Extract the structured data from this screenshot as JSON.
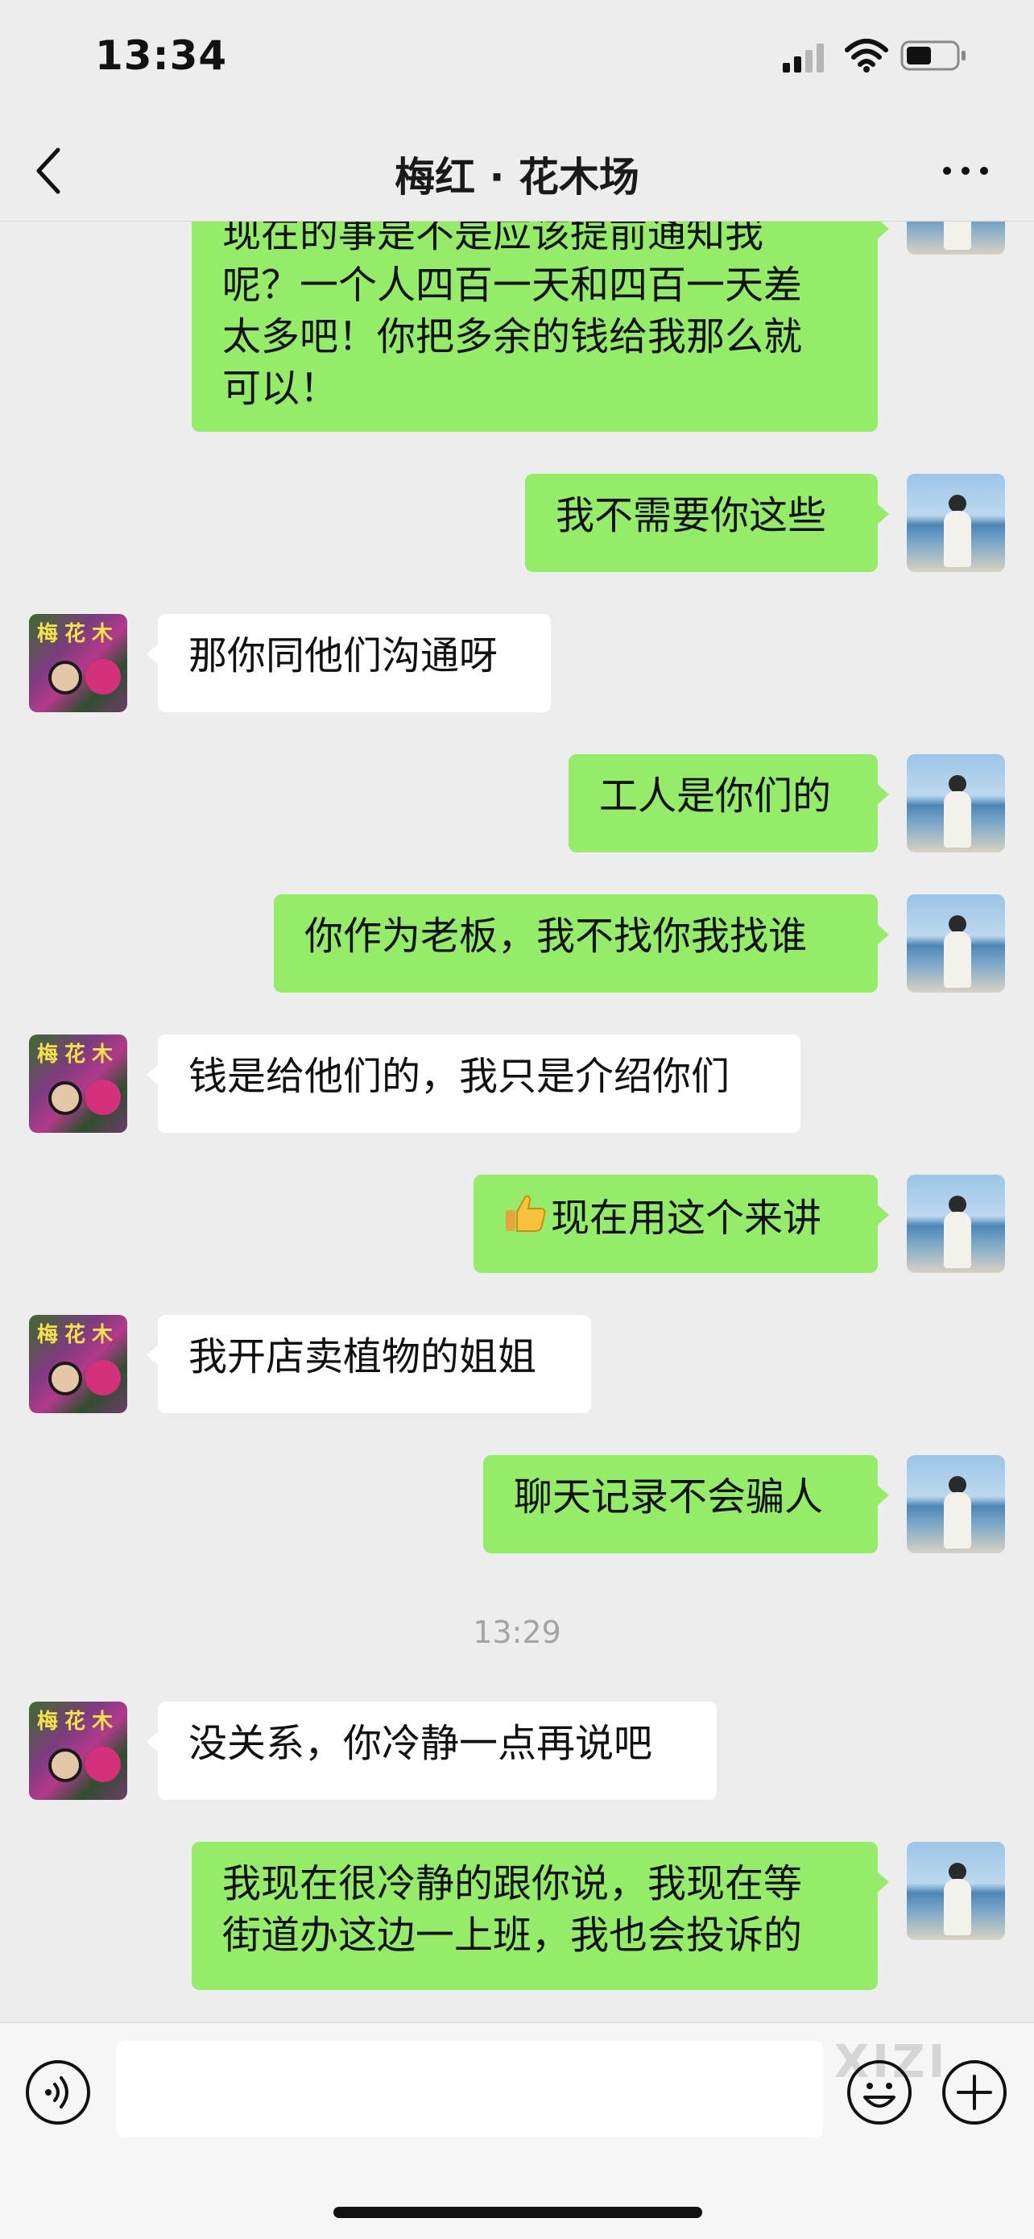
{
  "status_bar": {
    "time": "13:34"
  },
  "header": {
    "title": "梅红 · 花木场"
  },
  "chat": {
    "messages": [
      {
        "side": "me",
        "lines": [
          "现在的事是不是应该提前通知我",
          "呢？一个人四百一天和四百一天差",
          "太多吧！你把多余的钱给我那么就",
          "可以！"
        ]
      },
      {
        "side": "me",
        "text": "我不需要你这些"
      },
      {
        "side": "them",
        "text": "那你同他们沟通呀"
      },
      {
        "side": "me",
        "text": "工人是你们的"
      },
      {
        "side": "me",
        "text": "你作为老板，我不找你我找谁"
      },
      {
        "side": "them",
        "text": "钱是给他们的，我只是介绍你们"
      },
      {
        "side": "me",
        "emoji": "thumbs-up",
        "text": "现在用这个来讲"
      },
      {
        "side": "them",
        "text": "我开店卖植物的姐姐"
      },
      {
        "side": "me",
        "text": "聊天记录不会骗人"
      },
      {
        "side": "them",
        "text": "没关系，你冷静一点再说吧"
      },
      {
        "side": "me",
        "lines": [
          "我现在很冷静的跟你说，我现在等",
          "街道办这边一上班，我也会投诉的"
        ]
      }
    ],
    "timestamp": "13:29",
    "contact_avatar_label": "梅花木"
  },
  "input_bar": {
    "watermark": "XIZI"
  },
  "icons": [
    "back-chevron-icon",
    "more-dots-icon",
    "signal-icon",
    "wifi-icon",
    "battery-icon",
    "voice-icon",
    "emoji-icon",
    "plus-icon",
    "thumbs-up-icon"
  ],
  "colors": {
    "background": "#ededed",
    "my_bubble": "#95ec69",
    "their_bubble": "#ffffff"
  }
}
